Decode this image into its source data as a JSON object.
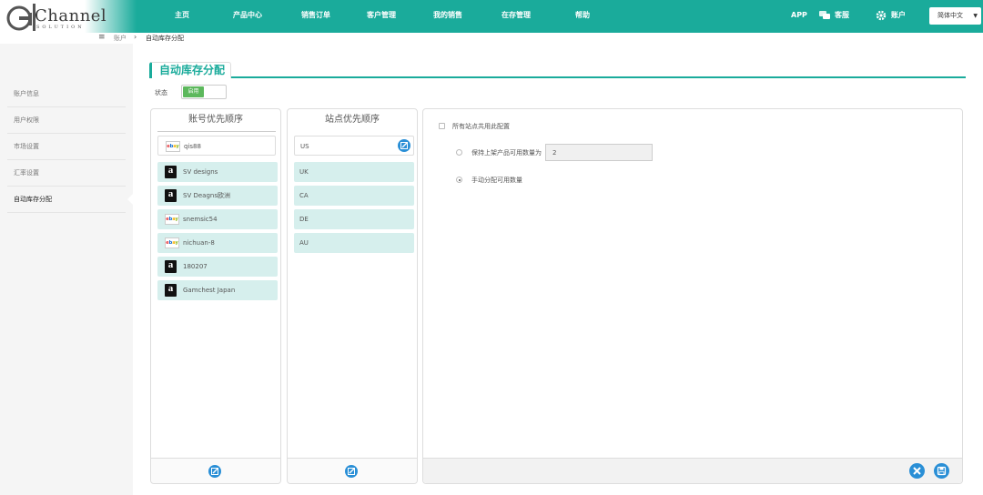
{
  "logo": {
    "text": "Channel",
    "sub": "SOLUTION"
  },
  "nav": [
    {
      "label": "主页"
    },
    {
      "label": "产品中心"
    },
    {
      "label": "销售订单"
    },
    {
      "label": "客户管理"
    },
    {
      "label": "我的销售"
    },
    {
      "label": "在存管理"
    },
    {
      "label": "帮助"
    }
  ],
  "topright": {
    "app": "APP",
    "service": "客服",
    "account": "账户",
    "language": "简体中文"
  },
  "breadcrumb": {
    "root": "账户",
    "current": "自动库存分配"
  },
  "sidebar": {
    "items": [
      {
        "label": "账户信息"
      },
      {
        "label": "用户权限"
      },
      {
        "label": "市场设置"
      },
      {
        "label": "汇率设置"
      },
      {
        "label": "自动库存分配"
      }
    ]
  },
  "page": {
    "title": "自动库存分配",
    "status_label": "状态",
    "status_value": "启用"
  },
  "accounts_panel": {
    "title": "账号优先顺序",
    "items": [
      {
        "name": "qis88",
        "platform": "ebay"
      },
      {
        "name": "SV designs",
        "platform": "amazon"
      },
      {
        "name": "SV Deagns欧洲",
        "platform": "amazon"
      },
      {
        "name": "snemsic54",
        "platform": "ebay"
      },
      {
        "name": "nichuan-8",
        "platform": "ebay"
      },
      {
        "name": "180207",
        "platform": "amazon"
      },
      {
        "name": "Gamchest Japan",
        "platform": "amazon"
      }
    ]
  },
  "sites_panel": {
    "title": "站点优先顺序",
    "items": [
      {
        "name": "US"
      },
      {
        "name": "UK"
      },
      {
        "name": "CA"
      },
      {
        "name": "DE"
      },
      {
        "name": "AU"
      }
    ]
  },
  "settings_panel": {
    "all_sites_label": "所有站点共用此配置",
    "option_keep_label": "保持上架产品可用数量为",
    "option_keep_value": "2",
    "option_manual_label": "手动分配可用数量",
    "selected_option": "manual"
  },
  "icons": {
    "edit": "edit-icon",
    "close": "close-icon",
    "save": "save-icon",
    "menu": "menu-icon"
  },
  "colors": {
    "brand": "#1aab9b",
    "row_highlight": "#d6efed",
    "action_blue": "#2a8fd6"
  }
}
